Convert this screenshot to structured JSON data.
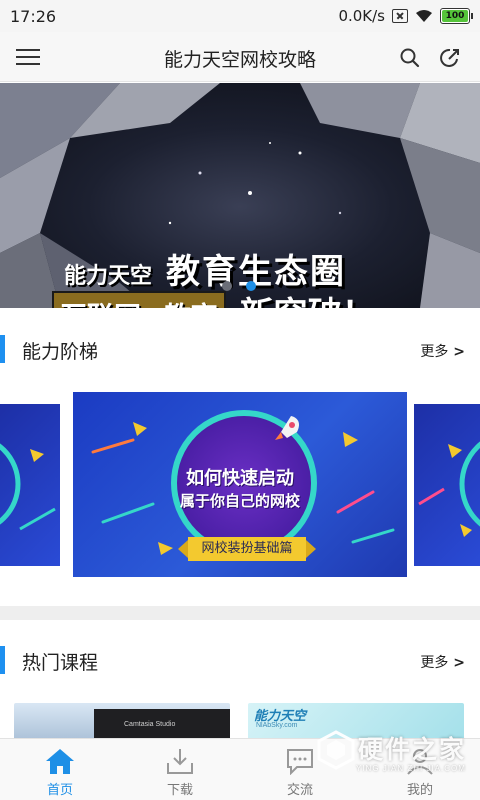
{
  "status_bar": {
    "time": "17:26",
    "speed": "0.0K/s",
    "battery": "100",
    "icons": [
      "sim-blocked-icon",
      "wifi-icon",
      "battery-icon"
    ]
  },
  "app_bar": {
    "title": "能力天空网校攻略",
    "icons": [
      "menu-icon",
      "search-icon",
      "share-icon"
    ]
  },
  "banner": {
    "brand": "能力天空",
    "headline": "教育生态圈",
    "subline_left": "互联网+教育",
    "subline_right": "新突破！",
    "slide_count": 2,
    "active_slide": 2
  },
  "sections": {
    "ladder": {
      "title": "能力阶梯",
      "more": "更多"
    },
    "courses": {
      "title": "热门课程",
      "more": "更多"
    }
  },
  "ladder_card": {
    "line1": "如何快速启动",
    "line2": "属于你自己的网校",
    "ribbon": "网校装扮基础篇"
  },
  "course_cards": [
    {
      "caption": "Camtasia Studio"
    },
    {
      "logo": "能力天空",
      "url": "NlAbSky.com"
    }
  ],
  "bottom_nav": [
    {
      "label": "首页",
      "icon": "home-icon",
      "active": true
    },
    {
      "label": "下载",
      "icon": "download-icon",
      "active": false
    },
    {
      "label": "交流",
      "icon": "chat-icon",
      "active": false
    },
    {
      "label": "我的",
      "icon": "profile-icon",
      "active": false
    }
  ],
  "watermark": {
    "title": "硬件之家",
    "subtitle": "YING JIAN ZHI JIA.COM"
  },
  "colors": {
    "accent": "#1e8fe6",
    "section_bar": "#1e90f0",
    "battery_green": "#55c43a"
  }
}
